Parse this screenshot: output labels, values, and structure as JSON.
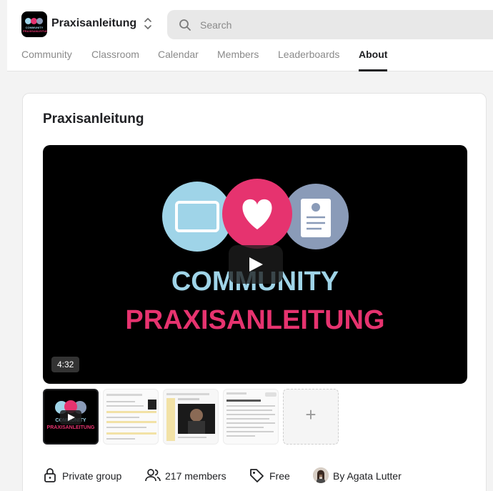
{
  "header": {
    "logo": {
      "line1": "COMMUNITY",
      "line2": "PRAXISANLEITUNG"
    },
    "group_name": "Praxisanleitung",
    "search_placeholder": "Search"
  },
  "tabs": [
    {
      "label": "Community",
      "active": false
    },
    {
      "label": "Classroom",
      "active": false
    },
    {
      "label": "Calendar",
      "active": false
    },
    {
      "label": "Members",
      "active": false
    },
    {
      "label": "Leaderboards",
      "active": false
    },
    {
      "label": "About",
      "active": true
    }
  ],
  "about": {
    "title": "Praxisanleitung",
    "video": {
      "line1": "COMMUNITY",
      "line2": "PRAXISANLEITUNG",
      "duration": "4:32"
    },
    "thumb_labels": {
      "line1": "COMMUNITY",
      "line2": "PRAXISANLEITUNG"
    },
    "add_media": "+",
    "meta": {
      "privacy": "Private group",
      "members": "217 members",
      "price": "Free",
      "owner": "By Agata Lutter"
    }
  },
  "colors": {
    "accent_pink": "#e6336f",
    "light_blue": "#9fd4e8",
    "slate_blue": "#8a9bb8",
    "text_dark": "#202124",
    "text_muted": "#8a8a8a"
  }
}
